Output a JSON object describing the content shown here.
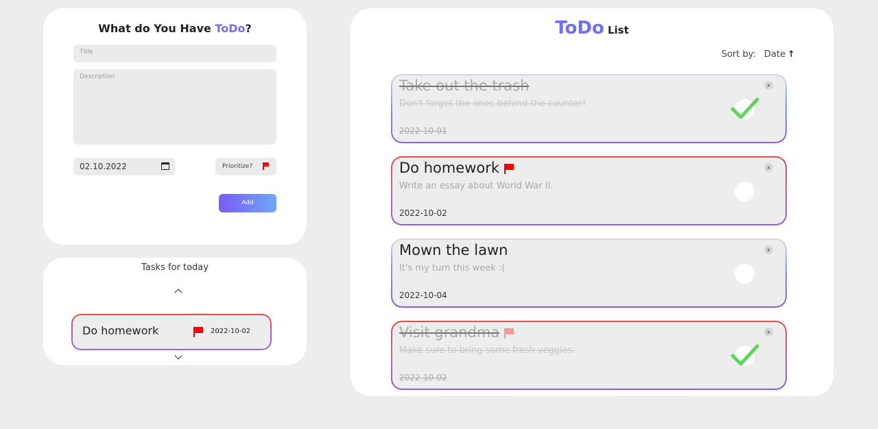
{
  "form": {
    "heading_main": "What do You Have ",
    "heading_accent": "ToDo",
    "heading_end": "?",
    "title_placeholder": "Title",
    "description_placeholder": "Description",
    "date_value": "02.10.2022",
    "prioritize_label": "Prioritize?",
    "add_label": "Add"
  },
  "today": {
    "heading": "Tasks for today",
    "item": {
      "title": "Do homework",
      "date": "2022-10-02",
      "priority": true
    }
  },
  "list": {
    "title_big": "ToDo",
    "title_small": "List",
    "sort_label": "Sort by:",
    "sort_value": "Date",
    "sort_arrow": "↑",
    "todos": [
      {
        "title": "Take out the trash",
        "description": "Don't forget the ones behind the counter!",
        "date": "2022-10-01",
        "priority": false,
        "done": true,
        "close": "x"
      },
      {
        "title": "Do homework",
        "description": "Write an essay about World War II.",
        "date": "2022-10-02",
        "priority": true,
        "done": false,
        "close": "x"
      },
      {
        "title": "Mown the lawn",
        "description": "It's my turn this week :(",
        "date": "2022-10-04",
        "priority": false,
        "done": false,
        "close": "x"
      },
      {
        "title": "Visit grandma",
        "description": "Make sure to bring some fresh veggies.",
        "date": "2022-10-02",
        "priority": true,
        "done": true,
        "close": "x"
      }
    ]
  },
  "colors": {
    "accent": "#6f6ff0",
    "priority_red": "#ff0000",
    "check_green": "#5ed45e",
    "background": "#ededed"
  }
}
